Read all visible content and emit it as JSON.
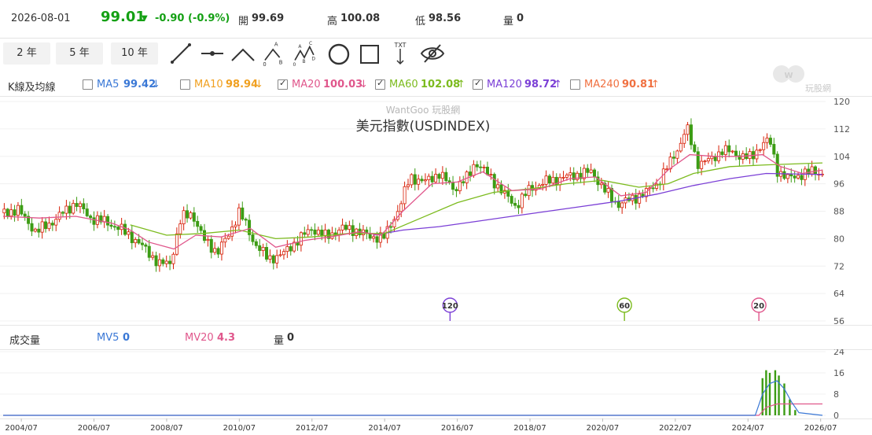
{
  "header": {
    "date": "2026-08-01",
    "price": "99.01",
    "change": "-0.90 (-0.9%)",
    "open_label": "開",
    "open_value": "99.69",
    "high_label": "高",
    "high_value": "100.08",
    "low_label": "低",
    "low_value": "98.56",
    "vol_label": "量",
    "vol_value": "0",
    "colors": {
      "down": "#14a014",
      "up": "#d81e06"
    }
  },
  "toolbar": {
    "ranges": [
      "2 年",
      "5 年",
      "10 年"
    ],
    "tools": [
      "line-tool-icon",
      "segment-tool-icon",
      "angle-tool-icon",
      "abc-pattern-tool-icon",
      "abcd-pattern-tool-icon",
      "circle-tool-icon",
      "rectangle-tool-icon",
      "text-tool-icon",
      "hide-drawings-icon"
    ]
  },
  "watermark_logo_text": "玩股網",
  "ma_legend": {
    "title": "K線及均線",
    "items": [
      {
        "label": "MA5",
        "value": "99.42",
        "arrow": "↓",
        "checked": false,
        "color": "#3a78d6"
      },
      {
        "label": "MA10",
        "value": "98.94",
        "arrow": "↓",
        "checked": false,
        "color": "#f0a020"
      },
      {
        "label": "MA20",
        "value": "100.03",
        "arrow": "↓",
        "checked": true,
        "color": "#e0578c"
      },
      {
        "label": "MA60",
        "value": "102.08",
        "arrow": "↑",
        "checked": true,
        "color": "#7cbb1e"
      },
      {
        "label": "MA120",
        "value": "98.72",
        "arrow": "↑",
        "checked": true,
        "color": "#7b3fd6"
      },
      {
        "label": "MA240",
        "value": "90.81",
        "arrow": "↑",
        "checked": false,
        "color": "#f07040"
      }
    ]
  },
  "volume_legend": {
    "title": "成交量",
    "mv5_label": "MV5",
    "mv5_value": "0",
    "mv20_label": "MV20",
    "mv20_value": "4.3",
    "vol_label": "量",
    "vol_value": "0"
  },
  "chart_data": {
    "type": "candlestick",
    "watermark": "WantGoo 玩股網",
    "title": "美元指數(USDINDEX)",
    "ylim": [
      56,
      120
    ],
    "yticks": [
      56,
      64,
      72,
      80,
      88,
      96,
      104,
      112,
      120
    ],
    "x_ticks": [
      "2004/07",
      "2006/07",
      "2008/07",
      "2010/07",
      "2012/07",
      "2014/07",
      "2016/07",
      "2018/07",
      "2020/07",
      "2022/07",
      "2024/07",
      "2026/07"
    ],
    "x_range": [
      2004.0,
      2026.55
    ],
    "close_series": [
      [
        2004.0,
        87.5
      ],
      [
        2004.4,
        88.5
      ],
      [
        2004.9,
        82.0
      ],
      [
        2005.3,
        84.5
      ],
      [
        2005.7,
        88.0
      ],
      [
        2006.0,
        90.5
      ],
      [
        2006.4,
        86.0
      ],
      [
        2006.8,
        85.0
      ],
      [
        2007.2,
        83.0
      ],
      [
        2007.6,
        80.0
      ],
      [
        2008.0,
        76.0
      ],
      [
        2008.3,
        72.5
      ],
      [
        2008.6,
        73.0
      ],
      [
        2008.9,
        86.0
      ],
      [
        2009.2,
        87.5
      ],
      [
        2009.5,
        80.0
      ],
      [
        2009.9,
        76.0
      ],
      [
        2010.2,
        81.0
      ],
      [
        2010.5,
        88.0
      ],
      [
        2010.9,
        79.0
      ],
      [
        2011.3,
        74.0
      ],
      [
        2011.7,
        75.5
      ],
      [
        2012.1,
        79.5
      ],
      [
        2012.5,
        83.0
      ],
      [
        2012.9,
        80.5
      ],
      [
        2013.3,
        83.0
      ],
      [
        2013.7,
        82.5
      ],
      [
        2014.1,
        80.5
      ],
      [
        2014.5,
        80.5
      ],
      [
        2014.9,
        89.0
      ],
      [
        2015.2,
        98.0
      ],
      [
        2015.6,
        96.5
      ],
      [
        2016.0,
        99.0
      ],
      [
        2016.4,
        94.5
      ],
      [
        2016.8,
        98.0
      ],
      [
        2017.0,
        102.5
      ],
      [
        2017.4,
        98.0
      ],
      [
        2017.8,
        93.0
      ],
      [
        2018.1,
        89.5
      ],
      [
        2018.5,
        94.5
      ],
      [
        2018.9,
        96.5
      ],
      [
        2019.3,
        97.5
      ],
      [
        2019.7,
        98.5
      ],
      [
        2020.2,
        99.5
      ],
      [
        2020.6,
        93.5
      ],
      [
        2020.9,
        90.0
      ],
      [
        2021.3,
        91.5
      ],
      [
        2021.7,
        93.5
      ],
      [
        2022.0,
        96.0
      ],
      [
        2022.4,
        103.0
      ],
      [
        2022.7,
        109.0
      ],
      [
        2022.8,
        113.0
      ],
      [
        2023.1,
        102.0
      ],
      [
        2023.5,
        103.0
      ],
      [
        2023.8,
        106.0
      ],
      [
        2024.2,
        104.5
      ],
      [
        2024.6,
        103.5
      ],
      [
        2024.9,
        108.0
      ],
      [
        2025.1,
        108.5
      ],
      [
        2025.3,
        100.0
      ],
      [
        2025.6,
        97.5
      ],
      [
        2025.9,
        98.5
      ],
      [
        2026.3,
        99.7
      ],
      [
        2026.55,
        99.01
      ]
    ],
    "ma20_series": [
      [
        2004.0,
        86.5
      ],
      [
        2005.0,
        86.0
      ],
      [
        2006.0,
        86.5
      ],
      [
        2007.0,
        84.5
      ],
      [
        2007.5,
        82.5
      ],
      [
        2008.0,
        79.0
      ],
      [
        2008.7,
        77.0
      ],
      [
        2009.3,
        81.0
      ],
      [
        2010.0,
        80.5
      ],
      [
        2010.8,
        83.0
      ],
      [
        2011.5,
        77.5
      ],
      [
        2012.3,
        79.5
      ],
      [
        2013.0,
        80.5
      ],
      [
        2013.8,
        82.0
      ],
      [
        2014.4,
        81.0
      ],
      [
        2015.0,
        88.0
      ],
      [
        2015.8,
        96.0
      ],
      [
        2016.5,
        96.5
      ],
      [
        2017.2,
        99.5
      ],
      [
        2018.0,
        94.0
      ],
      [
        2018.8,
        94.5
      ],
      [
        2019.6,
        97.5
      ],
      [
        2020.3,
        98.0
      ],
      [
        2021.0,
        92.5
      ],
      [
        2021.7,
        93.5
      ],
      [
        2022.3,
        100.0
      ],
      [
        2022.9,
        104.5
      ],
      [
        2023.6,
        104.0
      ],
      [
        2024.3,
        104.0
      ],
      [
        2024.9,
        104.5
      ],
      [
        2025.4,
        101.0
      ],
      [
        2026.0,
        99.0
      ],
      [
        2026.55,
        100.03
      ]
    ],
    "ma60_series": [
      [
        2007.5,
        84.0
      ],
      [
        2008.5,
        81.0
      ],
      [
        2009.5,
        81.5
      ],
      [
        2010.5,
        82.5
      ],
      [
        2011.5,
        80.0
      ],
      [
        2012.5,
        80.5
      ],
      [
        2013.5,
        81.5
      ],
      [
        2014.5,
        81.5
      ],
      [
        2015.5,
        86.0
      ],
      [
        2016.5,
        90.5
      ],
      [
        2017.5,
        93.5
      ],
      [
        2018.5,
        94.5
      ],
      [
        2019.5,
        96.0
      ],
      [
        2020.5,
        97.0
      ],
      [
        2021.5,
        95.0
      ],
      [
        2022.3,
        96.0
      ],
      [
        2023.0,
        99.0
      ],
      [
        2024.0,
        101.0
      ],
      [
        2025.0,
        101.5
      ],
      [
        2026.55,
        102.08
      ]
    ],
    "ma120_series": [
      [
        2014.2,
        81.0
      ],
      [
        2015.0,
        82.5
      ],
      [
        2016.0,
        83.5
      ],
      [
        2017.0,
        85.0
      ],
      [
        2018.0,
        86.5
      ],
      [
        2019.0,
        88.0
      ],
      [
        2020.0,
        89.5
      ],
      [
        2021.0,
        91.0
      ],
      [
        2022.0,
        93.0
      ],
      [
        2023.0,
        95.5
      ],
      [
        2024.0,
        97.5
      ],
      [
        2025.0,
        99.0
      ],
      [
        2026.55,
        98.72
      ]
    ],
    "ma_markers": [
      {
        "label": "120",
        "x": 2016.3,
        "color": "#7b3fd6"
      },
      {
        "label": "60",
        "x": 2021.1,
        "color": "#7cbb1e"
      },
      {
        "label": "20",
        "x": 2024.8,
        "color": "#e0578c"
      }
    ],
    "volume": {
      "ylim": [
        0,
        24
      ],
      "yticks": [
        0,
        8,
        16,
        24
      ],
      "bars": [
        [
          2024.9,
          14
        ],
        [
          2025.0,
          17
        ],
        [
          2025.1,
          16
        ],
        [
          2025.25,
          17
        ],
        [
          2025.35,
          15
        ],
        [
          2025.5,
          12
        ],
        [
          2025.65,
          6
        ],
        [
          2025.8,
          2
        ]
      ],
      "mv5": [
        [
          2004.0,
          0
        ],
        [
          2024.7,
          0
        ],
        [
          2024.9,
          8
        ],
        [
          2025.1,
          12
        ],
        [
          2025.3,
          13
        ],
        [
          2025.5,
          10
        ],
        [
          2025.7,
          5
        ],
        [
          2025.9,
          1
        ],
        [
          2026.55,
          0
        ]
      ],
      "mv20": [
        [
          2004.0,
          0
        ],
        [
          2024.8,
          0
        ],
        [
          2025.0,
          3
        ],
        [
          2025.3,
          4.3
        ],
        [
          2026.55,
          4.3
        ]
      ]
    }
  }
}
